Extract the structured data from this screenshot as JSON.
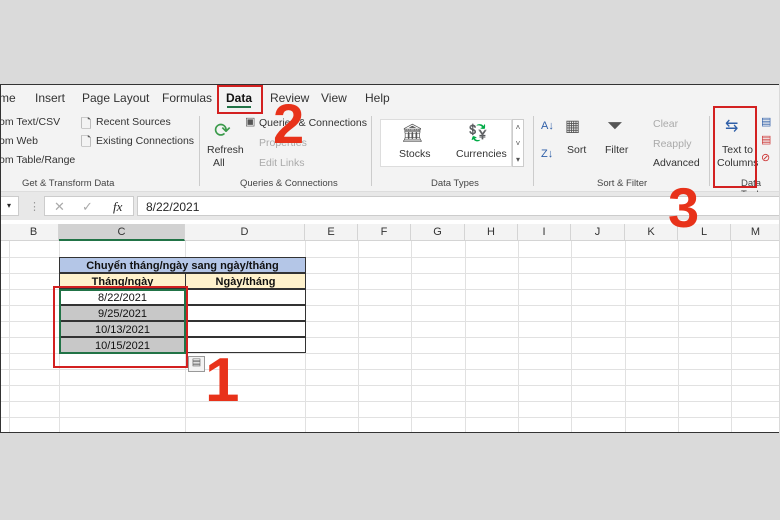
{
  "ribbon_tabs": [
    {
      "label": "me"
    },
    {
      "label": "Insert"
    },
    {
      "label": "Page Layout"
    },
    {
      "label": "Formulas"
    },
    {
      "label": "Data",
      "active": true
    },
    {
      "label": "Review"
    },
    {
      "label": "View"
    },
    {
      "label": "Help"
    }
  ],
  "get_transform": {
    "from_text": "om Text/CSV",
    "from_web": "om Web",
    "from_table": "om Table/Range",
    "recent": "Recent Sources",
    "existing": "Existing Connections",
    "group": "Get & Transform Data"
  },
  "queries": {
    "refresh": "Refresh",
    "all": "All",
    "queries_conn": "Queries & Connections",
    "properties": "Properties",
    "edit_links": "Edit Links",
    "group": "Queries & Connections"
  },
  "data_types": {
    "stocks": "Stocks",
    "currencies": "Currencies",
    "group": "Data Types"
  },
  "sort_filter": {
    "sort": "Sort",
    "filter": "Filter",
    "clear": "Clear",
    "reapply": "Reapply",
    "advanced": "Advanced",
    "group": "Sort & Filter"
  },
  "data_tools": {
    "text_to": "Text to",
    "columns": "Columns",
    "group": "Data Tools"
  },
  "formula_bar": {
    "value": "8/22/2021",
    "fx": "fx"
  },
  "columns": [
    "B",
    "C",
    "D",
    "E",
    "F",
    "G",
    "H",
    "I",
    "J",
    "K",
    "L",
    "M"
  ],
  "table": {
    "title": "Chuyển tháng/ngày sang ngày/tháng",
    "header_c": "Tháng/ngày",
    "header_d": "Ngày/tháng",
    "rows": [
      "8/22/2021",
      "9/25/2021",
      "10/13/2021",
      "10/15/2021"
    ]
  },
  "annotations": [
    "1",
    "2",
    "3"
  ],
  "colors": {
    "accent": "#217346",
    "annotation": "#d32020",
    "title_fill": "#b4c6e7",
    "header_fill": "#fff2cc"
  }
}
